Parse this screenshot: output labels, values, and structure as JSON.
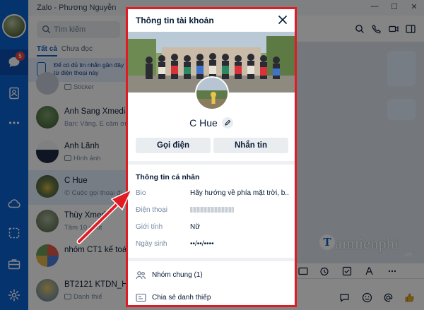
{
  "window": {
    "title": "Zalo - Phương Nguyễn",
    "min_icon": "minimize-icon",
    "max_icon": "maximize-icon",
    "close_icon": "close-icon"
  },
  "nav": {
    "messages_badge": "5"
  },
  "search": {
    "placeholder": "Tìm kiếm"
  },
  "list_tabs": {
    "all": "Tất cả",
    "unread": "Chưa đọc"
  },
  "notice": {
    "text": "Để có đủ tin nhắn gần đây từ điện thoại này"
  },
  "conversations": [
    {
      "name": "",
      "preview": "Sticker"
    },
    {
      "name": "Anh Sang Xmedia",
      "preview": "Bạn: Vâng. E cảm ơn"
    },
    {
      "name": "Anh Lãnh",
      "preview": "Hình ảnh"
    },
    {
      "name": "C Hue",
      "preview": "Cuộc gọi thoại đi"
    },
    {
      "name": "Thùy Xmedi",
      "preview": "Tâm 10 phút"
    },
    {
      "name": "nhóm CT1 kế toán",
      "preview": ""
    },
    {
      "name": "BT2121 KTDN_HVT",
      "preview": "Danh thiế"
    }
  ],
  "modal": {
    "title": "Thông tin tài khoản",
    "name": "C Hue",
    "call_button": "Gọi điện",
    "message_button": "Nhắn tin",
    "section_title": "Thông tin cá nhân",
    "fields": {
      "bio_label": "Bio",
      "bio_value": "Hãy hướng về phía mặt trời, b...",
      "phone_label": "Điện thoại",
      "gender_label": "Giới tính",
      "gender_value": "Nữ",
      "birthday_label": "Ngày sinh",
      "birthday_value": "••/••/••••"
    },
    "groups": "Nhóm chung (1)",
    "share": "Chia sẻ danh thiếp"
  },
  "watermark": {
    "logo": "T",
    "text": "aimienphi",
    "suffix": ".vn"
  },
  "colors": {
    "brand": "#0b63d4",
    "highlight_border": "#e01b24",
    "arrow": "#e01b24"
  }
}
